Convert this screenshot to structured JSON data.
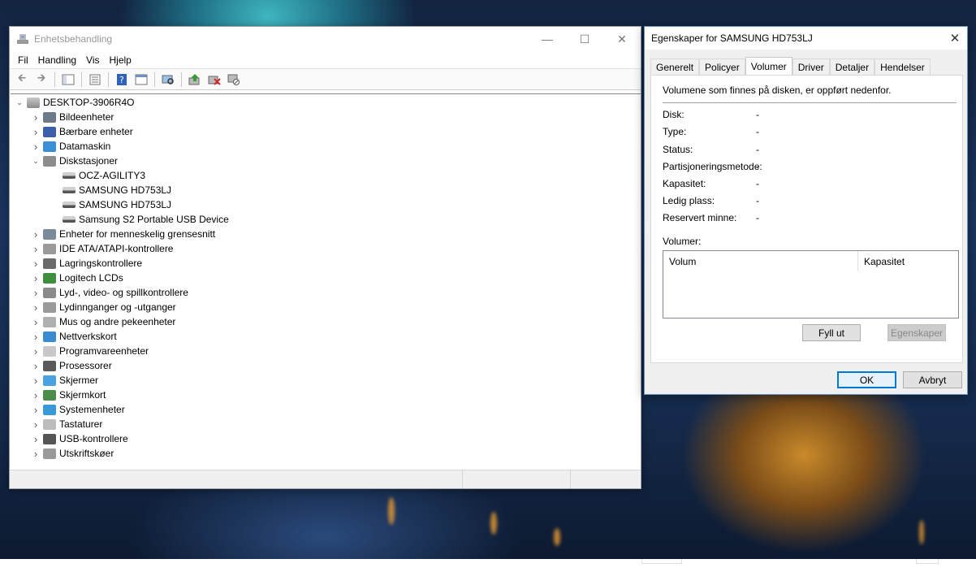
{
  "device_manager": {
    "title": "Enhetsbehandling",
    "menu": [
      "Fil",
      "Handling",
      "Vis",
      "Hjelp"
    ],
    "toolbar_icons": [
      "back-arrow-icon",
      "forward-arrow-icon",
      "show-hide-tree-icon",
      "properties-icon",
      "help-icon",
      "view-icon",
      "scan-hardware-icon",
      "update-driver-icon",
      "uninstall-device-icon",
      "disable-device-icon"
    ],
    "root": "DESKTOP-3906R4O",
    "categories": [
      {
        "label": "Bildeenheter",
        "icon": "camera-icon"
      },
      {
        "label": "Bærbare enheter",
        "icon": "portable-device-icon"
      },
      {
        "label": "Datamaskin",
        "icon": "computer-icon"
      },
      {
        "label": "Diskstasjoner",
        "icon": "disk-drive-icon",
        "expanded": true,
        "children": [
          "OCZ-AGILITY3",
          "SAMSUNG HD753LJ",
          "SAMSUNG HD753LJ",
          "Samsung S2 Portable USB Device"
        ]
      },
      {
        "label": "Enheter for menneskelig grensesnitt",
        "icon": "hid-icon"
      },
      {
        "label": "IDE ATA/ATAPI-kontrollere",
        "icon": "ide-controller-icon"
      },
      {
        "label": "Lagringskontrollere",
        "icon": "storage-controller-icon"
      },
      {
        "label": "Logitech LCDs",
        "icon": "lcd-icon"
      },
      {
        "label": "Lyd-, video- og spillkontrollere",
        "icon": "speaker-icon"
      },
      {
        "label": "Lydinnganger og -utganger",
        "icon": "audio-io-icon"
      },
      {
        "label": "Mus og andre pekeenheter",
        "icon": "mouse-icon"
      },
      {
        "label": "Nettverkskort",
        "icon": "network-adapter-icon"
      },
      {
        "label": "Programvareenheter",
        "icon": "software-device-icon"
      },
      {
        "label": "Prosessorer",
        "icon": "processor-icon"
      },
      {
        "label": "Skjermer",
        "icon": "monitor-icon"
      },
      {
        "label": "Skjermkort",
        "icon": "display-adapter-icon"
      },
      {
        "label": "Systemenheter",
        "icon": "system-device-icon"
      },
      {
        "label": "Tastaturer",
        "icon": "keyboard-icon"
      },
      {
        "label": "USB-kontrollere",
        "icon": "usb-icon"
      },
      {
        "label": "Utskriftskøer",
        "icon": "printer-icon"
      }
    ]
  },
  "properties_dialog": {
    "title": "Egenskaper for SAMSUNG HD753LJ",
    "tabs": [
      "Generelt",
      "Policyer",
      "Volumer",
      "Driver",
      "Detaljer",
      "Hendelser"
    ],
    "active_tab": "Volumer",
    "intro": "Volumene som finnes på disken, er oppført nedenfor.",
    "fields": [
      {
        "key": "Disk:",
        "value": "-"
      },
      {
        "key": "Type:",
        "value": "-"
      },
      {
        "key": "Status:",
        "value": "-"
      },
      {
        "key": "Partisjoneringsmetode:",
        "value": "-"
      },
      {
        "key": "Kapasitet:",
        "value": "-"
      },
      {
        "key": "Ledig plass:",
        "value": "-"
      },
      {
        "key": "Reservert minne:",
        "value": "-"
      }
    ],
    "volumes_label": "Volumer:",
    "volume_columns": [
      "Volum",
      "Kapasitet"
    ],
    "buttons": {
      "populate": "Fyll ut",
      "properties": "Egenskaper",
      "ok": "OK",
      "cancel": "Avbryt"
    }
  },
  "colors": {
    "selected_tab": "#ffffff",
    "dialog_bg": "#f0f0f0",
    "default_button_border": "#0078d7"
  }
}
